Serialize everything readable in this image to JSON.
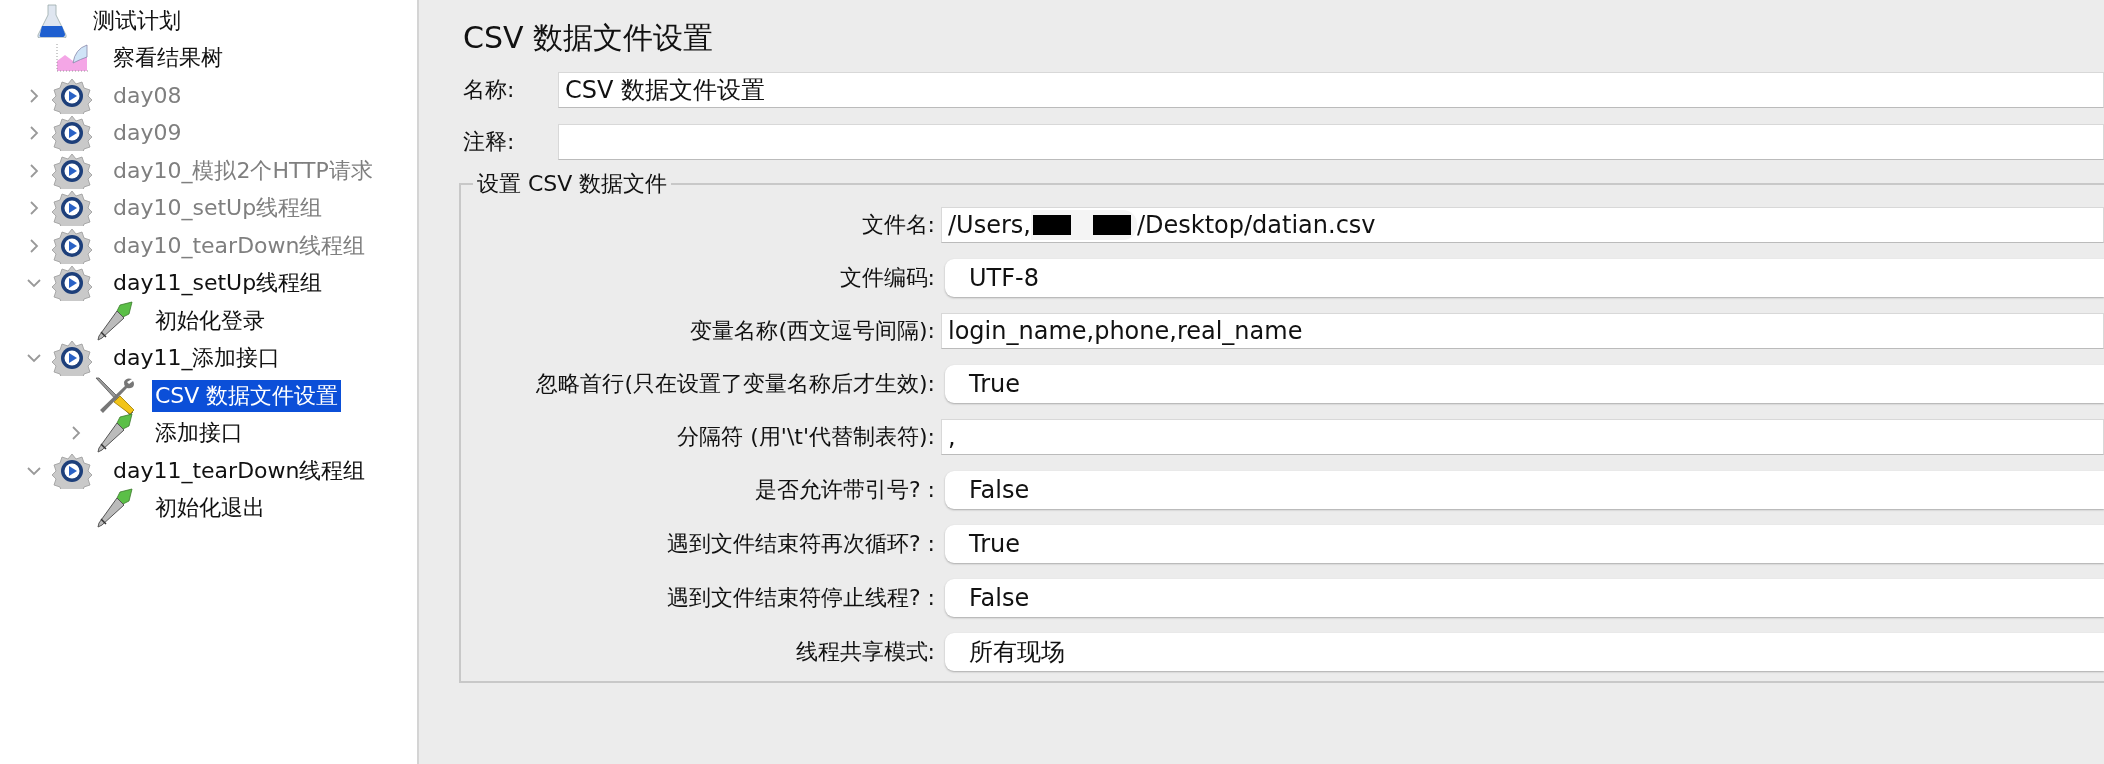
{
  "tree": [
    {
      "label": "测试计划",
      "kind": "plan",
      "disabled": false,
      "selected": false,
      "children": [
        {
          "label": "察看结果树",
          "kind": "listener",
          "disabled": false,
          "selected": false
        },
        {
          "label": "day08",
          "kind": "thread-group",
          "disabled": true,
          "selected": false,
          "expanded": false
        },
        {
          "label": "day09",
          "kind": "thread-group",
          "disabled": true,
          "selected": false,
          "expanded": false
        },
        {
          "label": "day10_模拟2个HTTP请求",
          "kind": "thread-group",
          "disabled": true,
          "selected": false,
          "expanded": false
        },
        {
          "label": "day10_setUp线程组",
          "kind": "thread-group",
          "disabled": true,
          "selected": false,
          "expanded": false
        },
        {
          "label": "day10_tearDown线程组",
          "kind": "thread-group",
          "disabled": true,
          "selected": false,
          "expanded": false
        },
        {
          "label": "day11_setUp线程组",
          "kind": "thread-group",
          "disabled": false,
          "selected": false,
          "expanded": true,
          "children": [
            {
              "label": "初始化登录",
              "kind": "sampler",
              "disabled": false,
              "selected": false
            }
          ]
        },
        {
          "label": "day11_添加接口",
          "kind": "thread-group",
          "disabled": false,
          "selected": false,
          "expanded": true,
          "children": [
            {
              "label": "CSV 数据文件设置",
              "kind": "config",
              "disabled": false,
              "selected": true
            },
            {
              "label": "添加接口",
              "kind": "sampler",
              "disabled": false,
              "selected": false,
              "expanded": false
            }
          ]
        },
        {
          "label": "day11_tearDown线程组",
          "kind": "thread-group",
          "disabled": false,
          "selected": false,
          "expanded": true,
          "children": [
            {
              "label": "初始化退出",
              "kind": "sampler",
              "disabled": false,
              "selected": false
            }
          ]
        }
      ]
    }
  ],
  "panel": {
    "title": "CSV 数据文件设置",
    "name": {
      "label": "名称:",
      "value": "CSV 数据文件设置"
    },
    "comment": {
      "label": "注释:"
    },
    "group": {
      "title": "设置 CSV 数据文件",
      "rows": [
        {
          "label": "文件名:",
          "kind": "path",
          "value_start": "/Users,",
          "value_end": "/Desktop/datian.csv"
        },
        {
          "label": "文件编码:",
          "kind": "select",
          "value": "UTF-8"
        },
        {
          "label": "变量名称(西文逗号间隔):",
          "kind": "text",
          "value": "login_name,phone,real_name"
        },
        {
          "label": "忽略首行(只在设置了变量名称后才生效):",
          "kind": "select",
          "value": "True"
        },
        {
          "label": "分隔符 (用'\\t'代替制表符):",
          "kind": "text",
          "value": ","
        },
        {
          "label": "是否允许带引号? :",
          "kind": "select",
          "value": "False"
        },
        {
          "label": "遇到文件结束符再次循环? :",
          "kind": "select",
          "value": "True"
        },
        {
          "label": "遇到文件结束符停止线程? :",
          "kind": "select",
          "value": "False"
        },
        {
          "label": "线程共享模式:",
          "kind": "select",
          "value": "所有现场"
        }
      ]
    }
  }
}
